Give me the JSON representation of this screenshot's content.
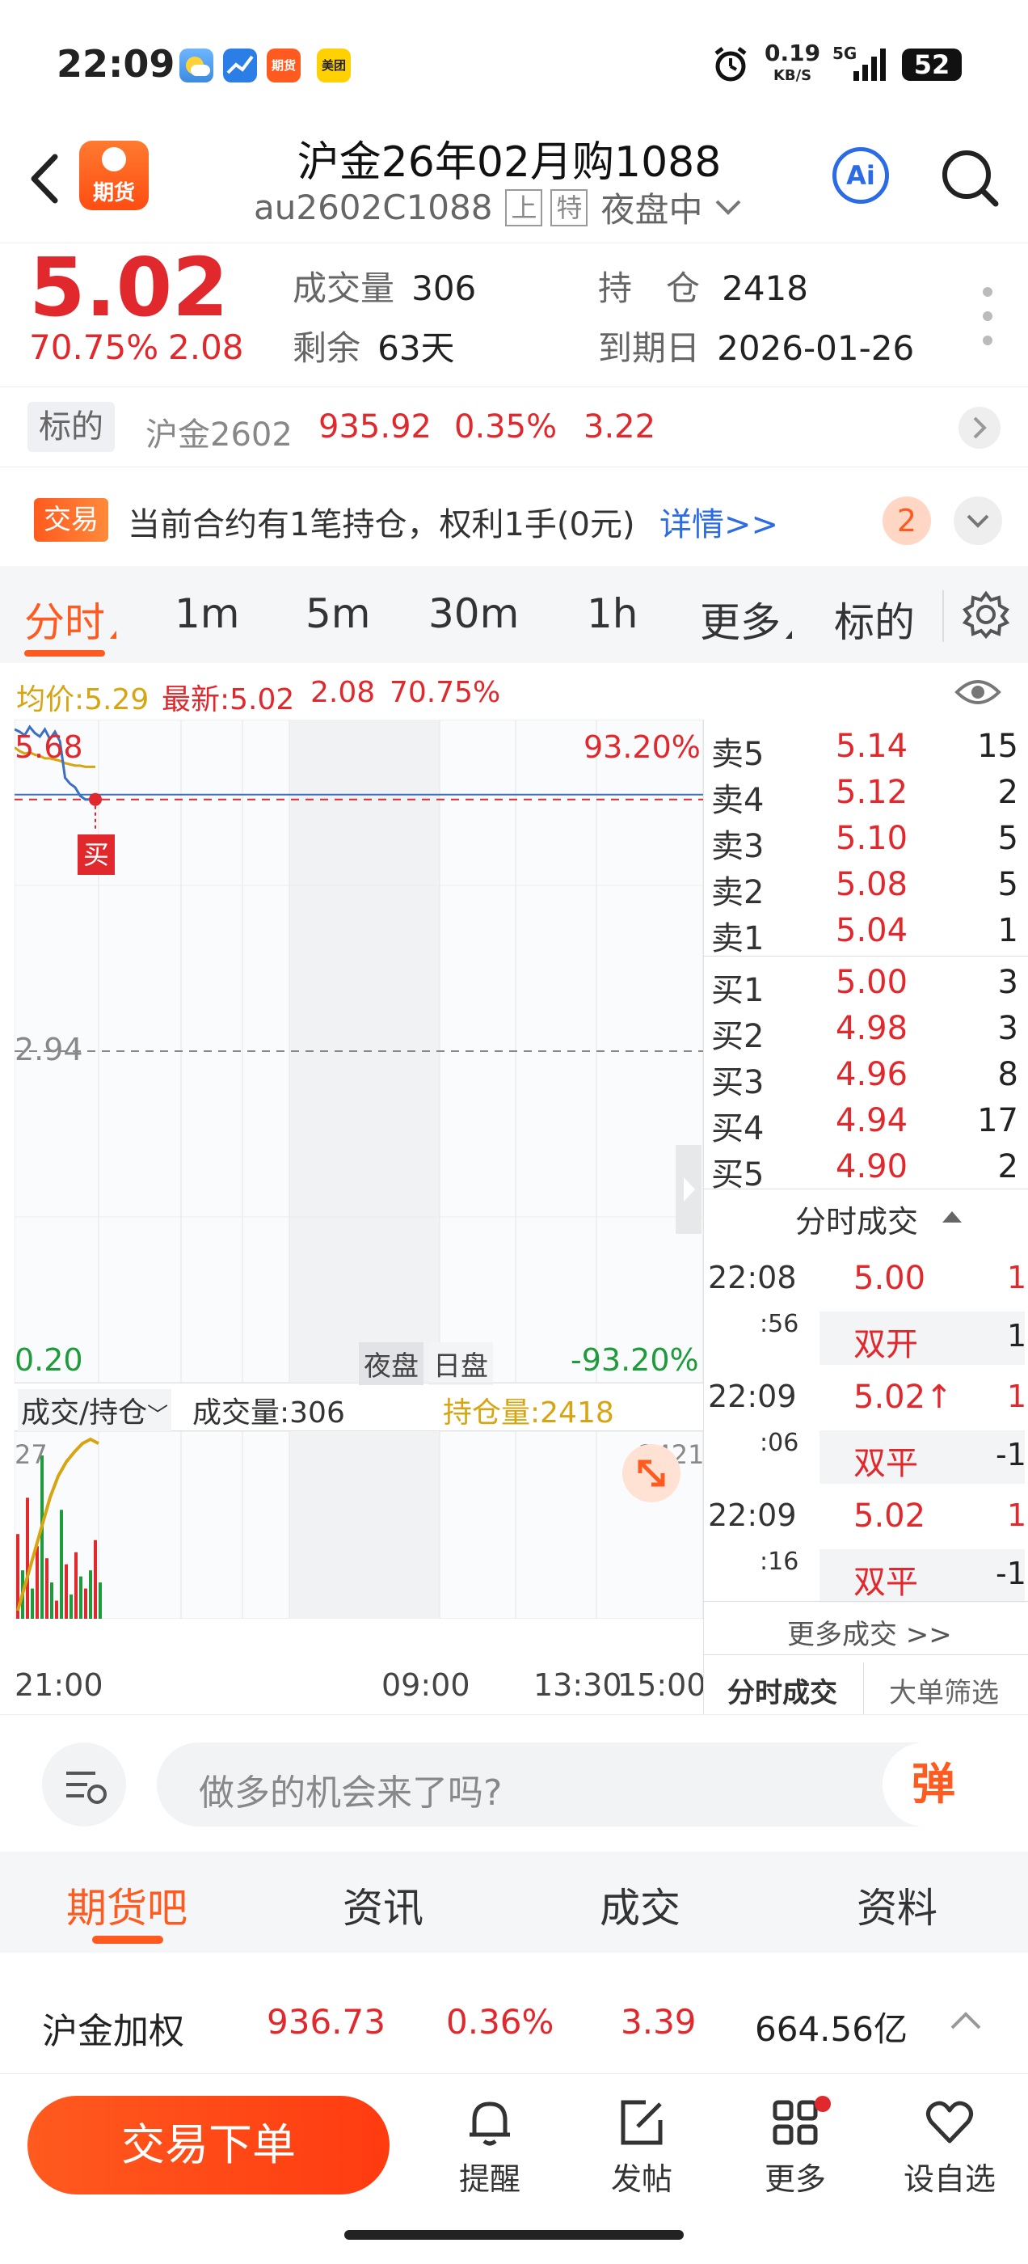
{
  "status": {
    "time": "22:09",
    "net_speed": "0.19",
    "net_unit": "KB/S",
    "signal": "5G",
    "battery": "52"
  },
  "status_apps": [
    "weather-app-icon",
    "stock-app-icon",
    "futures-app-icon",
    "meituan-app-icon"
  ],
  "status_app_labels": {
    "futures": "期货",
    "meituan": "美团"
  },
  "header": {
    "logo_text": "期货",
    "title": "沪金26年02月购1088",
    "code": "au2602C1088",
    "badge1": "上",
    "badge2": "特",
    "session": "夜盘中",
    "ai_label": "Ai"
  },
  "quote": {
    "price": "5.02",
    "change_pct": "70.75%",
    "change": "2.08",
    "volume_label": "成交量",
    "volume": "306",
    "open_interest_label": "持　仓",
    "open_interest": "2418",
    "remaining_label": "剩余",
    "remaining": "63天",
    "expiry_label": "到期日",
    "expiry": "2026-01-26"
  },
  "underlying": {
    "label": "标的",
    "name": "沪金2602",
    "price": "935.92",
    "pct": "0.35%",
    "change": "3.22"
  },
  "trade_notice": {
    "tag": "交易",
    "text": "当前合约有1笔持仓，权利1手(0元)",
    "link": "详情>>",
    "count": "2"
  },
  "tabs": [
    {
      "label": "分时",
      "active": true
    },
    {
      "label": "1m"
    },
    {
      "label": "5m"
    },
    {
      "label": "30m"
    },
    {
      "label": "1h"
    },
    {
      "label": "更多"
    },
    {
      "label": "标的"
    }
  ],
  "chart_info": {
    "avg_label": "均价:5.29",
    "latest_label": "最新:5.02",
    "change": "2.08",
    "pct": "70.75%"
  },
  "chart_data": {
    "type": "line",
    "y_top_label": "5.68",
    "y_mid_label": "2.94",
    "y_bottom_label": "0.20",
    "pct_top": "93.20%",
    "pct_bottom": "-93.20%",
    "ylim": [
      0.2,
      5.68
    ],
    "x_labels": [
      "21:00",
      "09:00",
      "13:30",
      "15:00"
    ],
    "session_labels": [
      "夜盘",
      "日盘"
    ],
    "buy_marker": "买",
    "price_series": [
      5.6,
      5.58,
      5.55,
      5.62,
      5.57,
      5.54,
      5.6,
      5.52,
      5.58,
      5.5,
      5.2,
      5.15,
      5.12,
      5.05,
      5.02,
      5.02,
      5.02
    ],
    "avg_series": [
      5.45,
      5.42,
      5.4,
      5.41,
      5.39,
      5.38,
      5.36,
      5.36,
      5.35,
      5.34,
      5.32,
      5.31,
      5.3,
      5.3,
      5.29,
      5.29,
      5.29
    ],
    "reference_line": 5.02,
    "prev_close_line": 2.94,
    "volume_panel": {
      "selector": "成交/持仓",
      "volume_label": "成交量:306",
      "oi_label": "持仓量:2418",
      "left_max": "27",
      "right_max": "2421",
      "volume_bars": [
        14,
        8,
        20,
        5,
        12,
        27,
        10,
        6,
        3,
        18,
        9,
        4,
        11,
        7,
        5,
        8,
        13,
        6
      ],
      "bar_colors": [
        "red",
        "green",
        "red",
        "green",
        "red",
        "green",
        "red",
        "green",
        "red",
        "green",
        "red",
        "green",
        "red",
        "green",
        "red",
        "green",
        "red",
        "green"
      ],
      "oi_series": [
        2300,
        2320,
        2340,
        2360,
        2380,
        2395,
        2405,
        2412,
        2418,
        2421,
        2418
      ]
    }
  },
  "order_book": {
    "asks": [
      {
        "label": "卖5",
        "price": "5.14",
        "qty": "15"
      },
      {
        "label": "卖4",
        "price": "5.12",
        "qty": "2"
      },
      {
        "label": "卖3",
        "price": "5.10",
        "qty": "5"
      },
      {
        "label": "卖2",
        "price": "5.08",
        "qty": "5"
      },
      {
        "label": "卖1",
        "price": "5.04",
        "qty": "1"
      }
    ],
    "bids": [
      {
        "label": "买1",
        "price": "5.00",
        "qty": "3"
      },
      {
        "label": "买2",
        "price": "4.98",
        "qty": "3"
      },
      {
        "label": "买3",
        "price": "4.96",
        "qty": "8"
      },
      {
        "label": "买4",
        "price": "4.94",
        "qty": "17"
      },
      {
        "label": "买5",
        "price": "4.90",
        "qty": "2"
      }
    ]
  },
  "ticks": {
    "title": "分时成交",
    "items": [
      {
        "time": "22:08",
        "sec": ":56",
        "price": "5.00",
        "qty": "1",
        "type": "双开",
        "type_qty": "1"
      },
      {
        "time": "22:09",
        "sec": ":06",
        "price": "5.02↑",
        "qty": "1",
        "type": "双平",
        "type_qty": "-1"
      },
      {
        "time": "22:09",
        "sec": ":16",
        "price": "5.02",
        "qty": "1",
        "type": "双平",
        "type_qty": "-1"
      }
    ],
    "more": "更多成交 >>",
    "tab1": "分时成交",
    "tab2": "大单筛选"
  },
  "input": {
    "placeholder": "做多的机会来了吗?",
    "danmaku": "弹"
  },
  "bottom_tabs": [
    {
      "label": "期货吧",
      "active": true
    },
    {
      "label": "资讯"
    },
    {
      "label": "成交"
    },
    {
      "label": "资料"
    }
  ],
  "index_bar": {
    "name": "沪金加权",
    "price": "936.73",
    "pct": "0.36%",
    "change": "3.39",
    "amount": "664.56亿"
  },
  "actions": {
    "trade_button": "交易下单",
    "items": [
      {
        "label": "提醒",
        "icon": "bell-icon"
      },
      {
        "label": "发帖",
        "icon": "edit-icon"
      },
      {
        "label": "更多",
        "icon": "grid-icon"
      },
      {
        "label": "设自选",
        "icon": "heart-icon"
      }
    ]
  },
  "colors": {
    "up": "#e0282d",
    "down": "#1e9b3a",
    "accent": "#ff5a1f",
    "avg": "#d6a511",
    "price_line": "#3a6fc4"
  }
}
